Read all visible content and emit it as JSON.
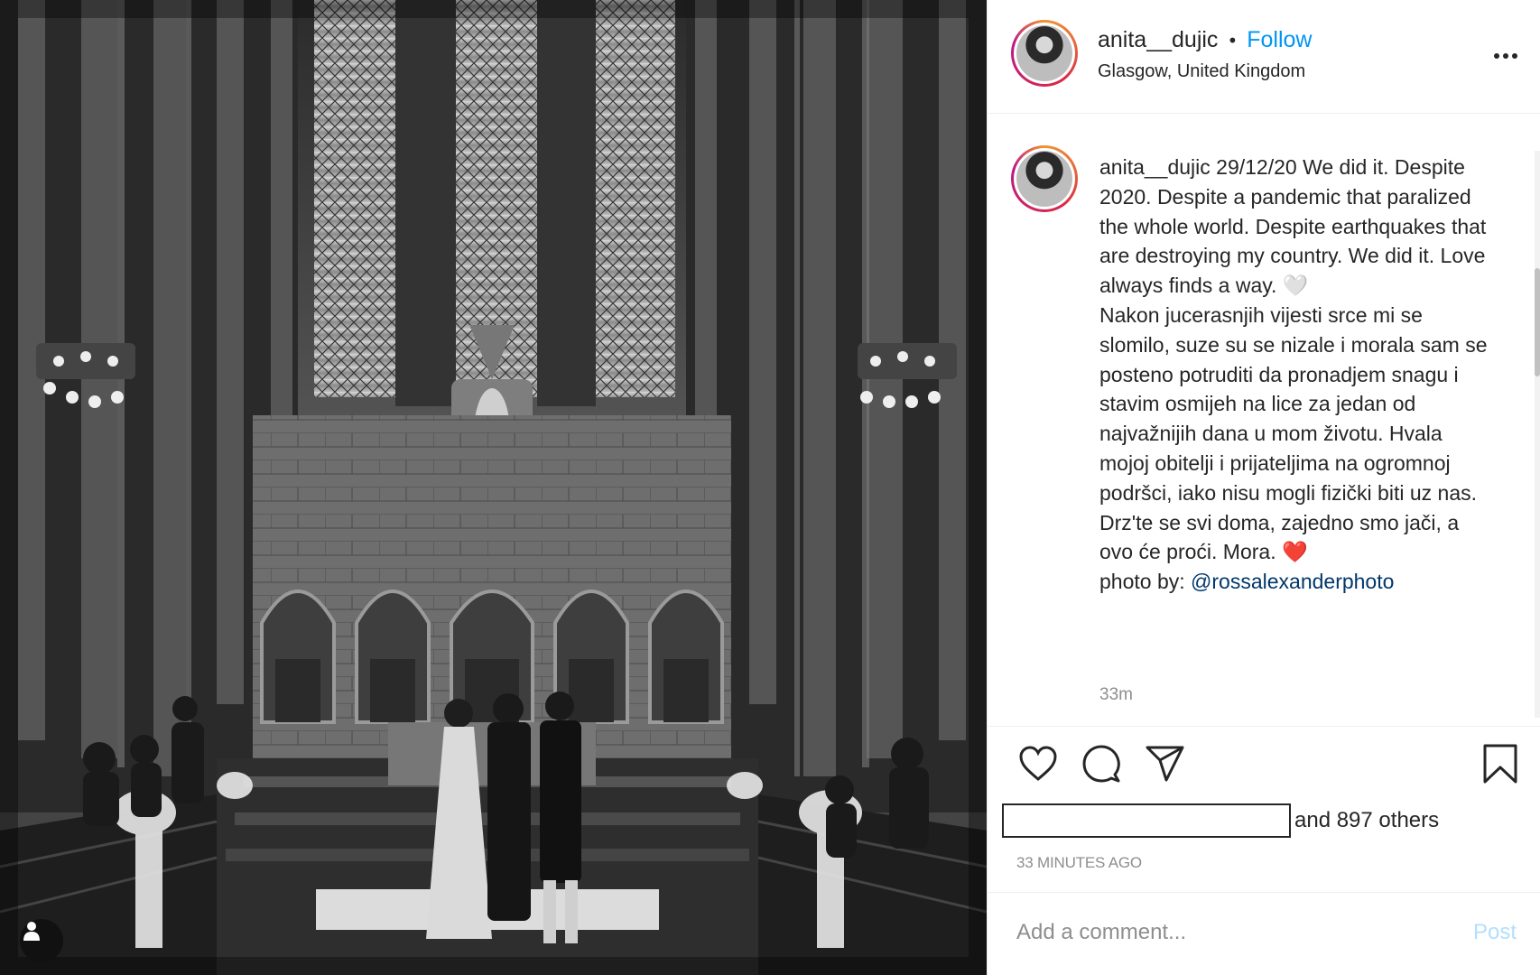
{
  "post": {
    "username": "anita__dujic",
    "separator": "•",
    "follow_label": "Follow",
    "location": "Glasgow, United Kingdom",
    "more_icon": "more-options-icon"
  },
  "caption": {
    "username": "anita__dujic",
    "text": " 29/12/20 We did it. Despite 2020. Despite a pandemic that paralized the whole world. Despite earthquakes that are destroying my country. We did it. Love always finds a way. 🤍\nNakon jucerasnjih vijesti srce mi se slomilo, suze su se nizale i morala sam se posteno potruditi da pronadjem snagu i stavim osmijeh na lice za jedan od najvažnijih dana u mom životu. Hvala mojoj obitelji i prijateljima na ogromnoj podršci, iako nisu mogli fizički biti uz nas. Drz'te se svi doma, zajedno smo jači, a ovo će proći. Mora. ❤️\nphoto by: ",
    "mention": "@rossalexanderphoto",
    "time_ago": "33m"
  },
  "actions": {
    "like_icon": "heart-icon",
    "comment_icon": "comment-icon",
    "share_icon": "share-icon",
    "save_icon": "bookmark-icon"
  },
  "likes": {
    "others_text": "and 897 others"
  },
  "date": "33 MINUTES AGO",
  "comment_box": {
    "placeholder": "Add a comment...",
    "post_label": "Post"
  },
  "colors": {
    "link_blue": "#0095f6",
    "post_disabled": "#b2dffc",
    "muted": "#8e8e8e",
    "text": "#262626"
  }
}
